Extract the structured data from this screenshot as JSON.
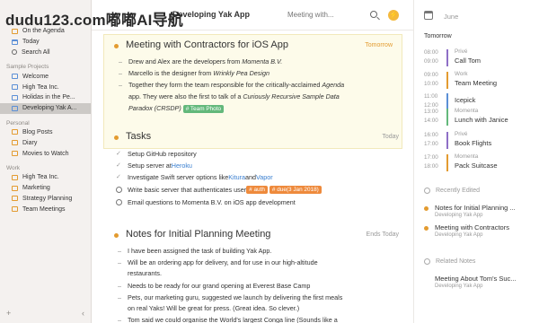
{
  "watermark": "dudu123.com嘟嘟AI导航",
  "sidebar": {
    "top_items": [
      {
        "label": "On the Agenda",
        "icon": "agenda-icon"
      },
      {
        "label": "Today",
        "icon": "calendar-icon"
      },
      {
        "label": "Search All",
        "icon": "search-icon"
      }
    ],
    "sections": [
      {
        "label": "Sample Projects",
        "items": [
          "Welcome",
          "High Tea Inc.",
          "Holidas in the Pe...",
          "Developing Yak A..."
        ]
      },
      {
        "label": "Personal",
        "items": [
          "Blog Posts",
          "Diary",
          "Movies to Watch"
        ]
      },
      {
        "label": "Work",
        "items": [
          "High Tea Inc.",
          "Marketing",
          "Strategy Planning",
          "Team Meetings"
        ]
      }
    ],
    "add_label": "+",
    "back_label": "‹"
  },
  "header": {
    "title": "Developing Yak App",
    "search_placeholder": "Meeting with..."
  },
  "meeting": {
    "title": "Meeting with Contractors for iOS App",
    "date": "Tomorrow",
    "line1_pre": "Drew and Alex are the developers from ",
    "line1_em": "Momenta B.V.",
    "line2_pre": "Marcello is the designer from ",
    "line2_em": "Wrinkly Pea Design",
    "line3a_pre": "Together they form the team responsible for the critically-acclaimed ",
    "line3a_em": "Agenda",
    "line3b_pre": "app. They were also the first to talk of a ",
    "line3b_em": "Curiously Recursive Sample Data",
    "line3c_em": "Paradox (CRSDP)",
    "tag": "# Team Photo"
  },
  "tasks": {
    "title": "Tasks",
    "date": "Today",
    "items": [
      {
        "done": true,
        "pre": "Setup GitHub repository",
        "link": "",
        "mid": "",
        "link2": ""
      },
      {
        "done": true,
        "pre": "Setup server at ",
        "link": "Heroku",
        "mid": "",
        "link2": ""
      },
      {
        "done": true,
        "pre": "Investigate Swift server options like ",
        "link": "Kitura",
        "mid": " and ",
        "link2": "Vapor"
      },
      {
        "done": false,
        "pre": "Write basic server that authenticates user ",
        "tag1": "# auth",
        "tag2": "# due(3 Jan 2018)"
      },
      {
        "done": false,
        "pre": "Email questions to Momenta B.V. on iOS app development"
      }
    ]
  },
  "notes": {
    "title": "Notes for Initial Planning Meeting",
    "date": "Ends Today",
    "lines": [
      "I have been assigned the task of building Yak App.",
      "Will be an ordering app for delivery, and for use in our high-altitude",
      "restaurants.",
      "Needs to be ready for our grand opening at Everest Base Camp",
      "Pets, our marketing guru, suggested we launch by delivering the first meals",
      "on real Yaks! Will be great for press. (Great idea. So clever.)",
      "Tom said we could organise the World's largest Conga line (Sounds like a"
    ]
  },
  "right": {
    "month": "June",
    "tomorrow": "Tomorrow",
    "events": [
      {
        "t1": "08:00",
        "t2": "09:00",
        "cal": "Privé",
        "name": "Call Tom",
        "color": "#8e6fc6"
      },
      {
        "t1": "09:00",
        "t2": "10:00",
        "cal": "Work",
        "name": "Team Meeting",
        "color": "#e39b30"
      },
      {
        "t1": "11:00",
        "t2": "12:00",
        "cal": "",
        "name": "Icepick",
        "color": "#5b8fd6"
      },
      {
        "t1": "13:00",
        "t2": "14:00",
        "cal": "Momenta",
        "name": "Lunch with Janice",
        "color": "#63b87b"
      },
      {
        "t1": "16:00",
        "t2": "17:00",
        "cal": "Privé",
        "name": "Book Flights",
        "color": "#8e6fc6"
      },
      {
        "t1": "17:00",
        "t2": "18:00",
        "cal": "Momenta",
        "name": "Pack Suitcase",
        "color": "#e39b30"
      }
    ],
    "recent_label": "Recently Edited",
    "recent": [
      {
        "name": "Notes for Initial Planning ...",
        "sub": "Developing Yak App"
      },
      {
        "name": "Meeting with Contractors",
        "sub": "Developing Yak App"
      }
    ],
    "related_label": "Related Notes",
    "related": [
      {
        "name": "Meeting About Tom's Suc...",
        "sub": "Developing Yak App"
      }
    ]
  }
}
